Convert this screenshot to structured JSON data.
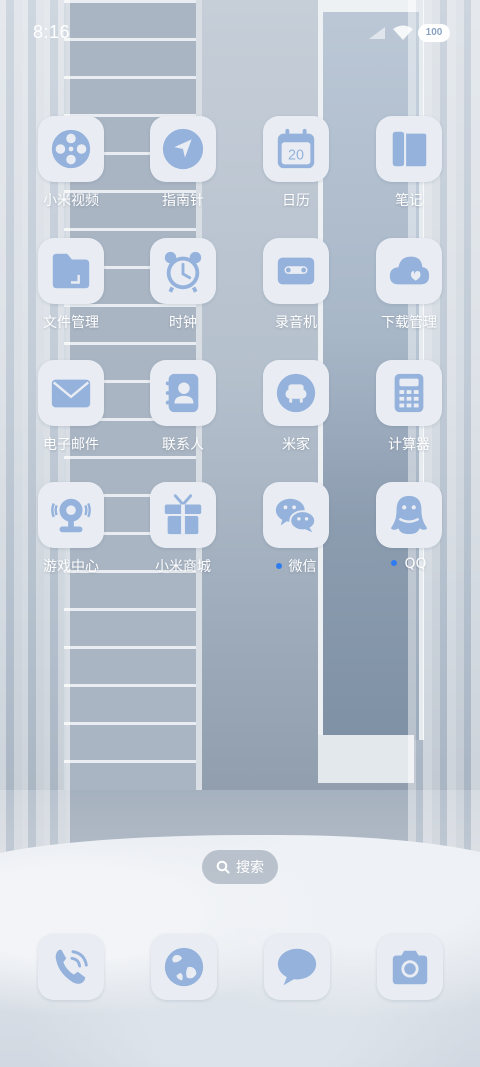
{
  "status_bar": {
    "time": "8:16",
    "battery": "100"
  },
  "apps": [
    {
      "label": "小米视频",
      "icon": "film-reel-icon"
    },
    {
      "label": "指南针",
      "icon": "compass-icon"
    },
    {
      "label": "日历",
      "icon": "calendar-icon",
      "calendar_day": "20"
    },
    {
      "label": "笔记",
      "icon": "notebook-icon"
    },
    {
      "label": "文件管理",
      "icon": "folder-icon"
    },
    {
      "label": "时钟",
      "icon": "alarm-clock-icon"
    },
    {
      "label": "录音机",
      "icon": "cassette-icon"
    },
    {
      "label": "下载管理",
      "icon": "cloud-download-icon"
    },
    {
      "label": "电子邮件",
      "icon": "envelope-icon"
    },
    {
      "label": "联系人",
      "icon": "contacts-icon"
    },
    {
      "label": "米家",
      "icon": "smart-home-icon"
    },
    {
      "label": "计算器",
      "icon": "calculator-icon"
    },
    {
      "label": "游戏中心",
      "icon": "game-controller-icon"
    },
    {
      "label": "小米商城",
      "icon": "gift-box-icon"
    },
    {
      "label": "微信",
      "icon": "wechat-icon",
      "notification_dot": true
    },
    {
      "label": "QQ",
      "icon": "qq-penguin-icon",
      "notification_dot": true
    }
  ],
  "search": {
    "label": "搜索"
  },
  "dock": [
    {
      "icon": "phone-icon"
    },
    {
      "icon": "browser-globe-icon"
    },
    {
      "icon": "messages-icon"
    },
    {
      "icon": "camera-icon"
    }
  ],
  "colors": {
    "icon_fill": "#94b2dc",
    "tile_bg": "#e9edf3",
    "notification_dot": "#2f7cf0"
  }
}
